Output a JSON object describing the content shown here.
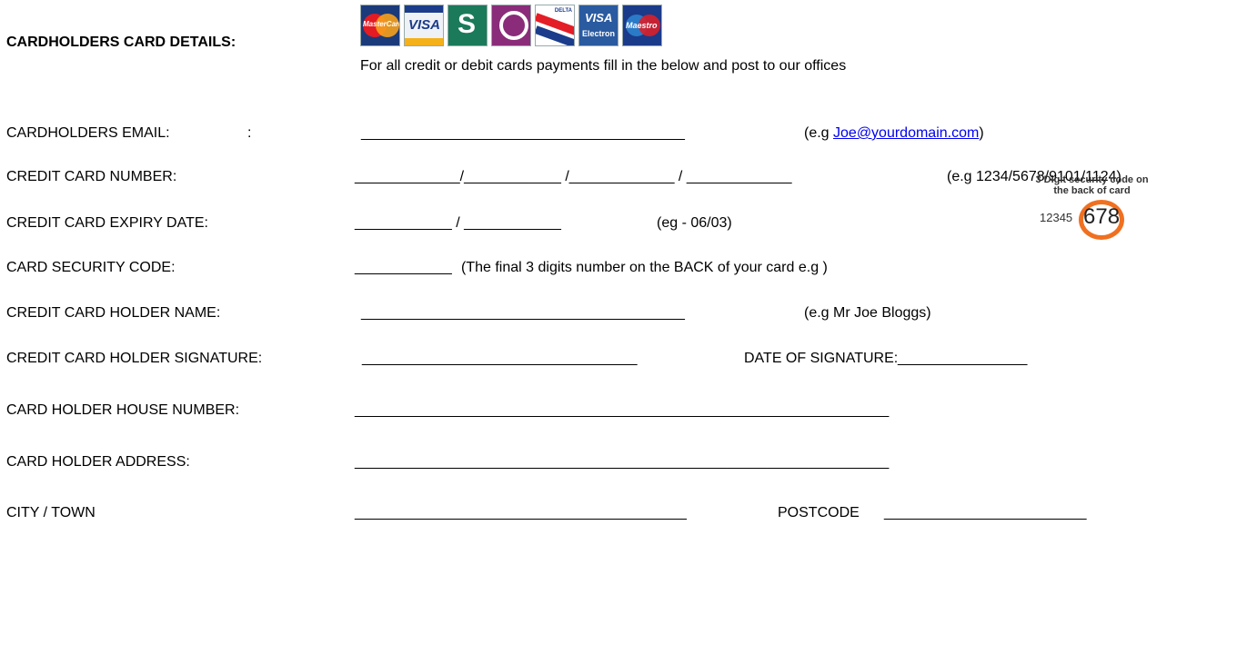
{
  "header": {
    "title": "CARDHOLDERS CARD DETAILS:",
    "instruction": "For all credit or debit cards payments fill in the below and post to our offices",
    "card_logos": [
      "MasterCard",
      "VISA",
      "Switch",
      "Solo",
      "DELTA",
      "VISA Electron",
      "Maestro"
    ]
  },
  "form": {
    "email_label": "CARDHOLDERS EMAIL:",
    "email_colon": ":",
    "email_line": "________________________________________",
    "email_hint_prefix": "(e.g ",
    "email_hint_link": "Joe@yourdomain.com",
    "email_hint_suffix": ")",
    "card_number_label": "CREDIT CARD NUMBER:",
    "card_number_line": "_____________/____________ /_____________ / _____________",
    "card_number_hint": "(e.g 1234/5678/9101/1124)",
    "expiry_label": "CREDIT CARD EXPIRY DATE:",
    "expiry_line": "____________ / ____________",
    "expiry_hint": "(eg - 06/03)",
    "security_label": "CARD SECURITY CODE:",
    "security_line": "____________",
    "security_hint": "(The final 3 digits number on the BACK of your card e.g )",
    "holder_name_label": "CREDIT CARD HOLDER NAME:",
    "holder_name_line": "________________________________________",
    "holder_name_hint": "(e.g Mr Joe Bloggs)",
    "signature_label": "CREDIT CARD HOLDER SIGNATURE:",
    "signature_line": "__________________________________",
    "date_signature_label": "DATE OF SIGNATURE:",
    "date_signature_line": "________________",
    "house_number_label": "CARD HOLDER HOUSE NUMBER:",
    "house_number_line": "__________________________________________________________________",
    "address_label": "CARD HOLDER ADDRESS:",
    "address_line": "__________________________________________________________________",
    "city_label": "CITY / TOWN",
    "city_line": "_________________________________________",
    "postcode_label": "POSTCODE",
    "postcode_line": "_________________________"
  },
  "security_example": {
    "caption": "3 Digit security code on the back of card",
    "digits_prefix": "12345",
    "code": "678",
    "ring_color": "#f07020"
  }
}
